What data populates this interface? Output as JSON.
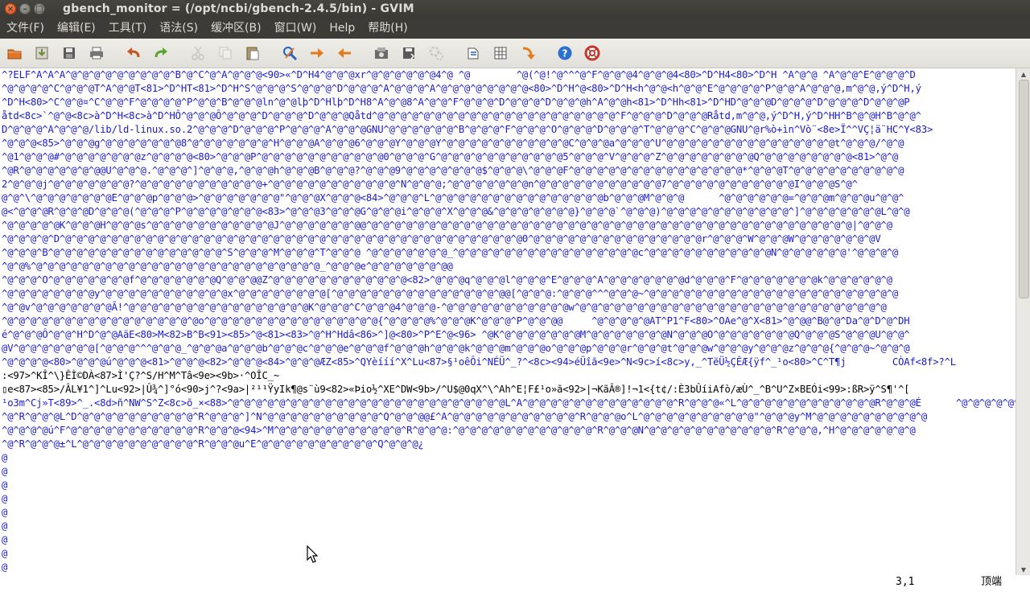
{
  "window": {
    "title": "gbench_monitor = (/opt/ncbi/gbench-2.4.5/bin) - GVIM",
    "close_glyph": "×",
    "min_glyph": "–",
    "max_glyph": "□"
  },
  "menubar": {
    "items": [
      "文件(F)",
      "编辑(E)",
      "工具(T)",
      "语法(S)",
      "缓冲区(B)",
      "窗口(W)",
      "Help",
      "帮助(H)"
    ]
  },
  "toolbar": {
    "buttons": [
      {
        "icon": "open-folder-icon",
        "color": "#e0762a"
      },
      {
        "icon": "download-save-icon",
        "color": "#6a8f2c"
      },
      {
        "icon": "save-disk-icon",
        "color": "#555555"
      },
      {
        "icon": "print-icon",
        "color": "#666666"
      },
      {
        "icon": "undo-icon",
        "color": "#c8551c"
      },
      {
        "icon": "redo-icon",
        "color": "#5aa632"
      },
      {
        "icon": "cut-icon",
        "color": "#888888"
      },
      {
        "icon": "copy-icon",
        "color": "#888888"
      },
      {
        "icon": "paste-icon",
        "color": "#7a6a4a"
      },
      {
        "icon": "find-replace-icon",
        "color": "#2b5fb8"
      },
      {
        "icon": "find-next-icon",
        "color": "#e37b1c"
      },
      {
        "icon": "find-prev-icon",
        "color": "#e37b1c"
      },
      {
        "icon": "load-session-icon",
        "color": "#555555"
      },
      {
        "icon": "save-session-icon",
        "color": "#555555"
      },
      {
        "icon": "run-script-icon",
        "color": "#888888"
      },
      {
        "icon": "make-icon",
        "color": "#2b5fb8"
      },
      {
        "icon": "build-tags-icon",
        "color": "#555555"
      },
      {
        "icon": "jump-tag-icon",
        "color": "#e37b1c"
      },
      {
        "icon": "help-icon",
        "color": "#2b6fd0"
      },
      {
        "icon": "find-help-icon",
        "color": "#c0392b"
      }
    ]
  },
  "editor": {
    "text_color": "#1a1ad0",
    "lines": [
      "^?ELF^A^A^A^@^@^@^@^@^@^@^@^@^B^@^C^@^A^@^@^@<90>«^D^H4^@^@^@xr^@^@^@^@^@^@4^@ ^@        ^@(^@!^@^^^@^F^@^@^@4^@^@^@4<80>^D^H4<80>^D^H ^A^@^@ ^A^@^@^E^@^@^@^D",
      "^@^@^@^@^C^@^@^@T^A^@^@T<81>^D^HT<81>^D^H^S^@^@^@^S^@^@^@^D^@^@^@^A^@^@^@^A^@^@^@^@^@^@^@^@<80>^D^H^@<80>^D^H<h^@^@<h^@^@^E^@^@^@^@^P^@^@^A^@^@^@,m^@^@,ý^D^H,ý",
      "^D^H<80>^C^@^@¤^C^@^@^F^@^@^@^@^P^@^@^B^@^@^@ln^@^@lþ^D^Hlþ^D^H8^A^@^@8^A^@^@^F^@^@^@^D^@^@^@^D^@^@^@h^A^@^@h<81>^D^Hh<81>^D^HD^@^@^@D^@^@^@^D^@^@^@^D^@^@^@P",
      "åtd<8c>`^@^@<8c>à^D^H<8c>à^D^HÔ^@^@^@Ô^@^@^@^D^@^@^@^D^@^@^@Qåtd^@^@^@^@^@^@^@^@^@^@^@^@^@^@^@^@^@^@^@^@^@^F^@^@^@^D^@^@^@Råtd,m^@^@,ý^D^H,ý^D^HH^B^@^@H^B^@^@^",
      "D^@^@^@^A^@^@^@/lib/ld-linux.so.2^@^@^@^D^@^@^@^P^@^@^@^A^@^@^@GNU^@^@^@^@^@^@^B^@^@^@^F^@^@^@^O^@^@^@^D^@^@^@^T^@^@^@^C^@^@^@GNU^@r%ò+ìn^Vò¨<8e>Ï^^VÇ¦ä¨HC^Y<83>",
      "^@^@^@<85>^@^@^@g^@^@^@^@^@^@^@8^@^@^@^@^@^@^@^H^@^@^@A^@^@^@6^@^@^@Y^@^@^@Y^@^@^@^@^@^@^@^@^@^@^@C^@^@^@a^@^@^@^U^@^@^@^@^@^@^@^@^@^@^@^@^@^@^@t^@^@^@/^@^@",
      "^@1^@^@^@#^@^@^@^@^@^@^@z^@^@^@^@<80>^@^@^@P^@^@^@^@^@^@^@^@^@^@^@0^@^@^@^G^@^@^@^@^@^@^@^@^@^@^@5^@^@^@^V^@^@^@^Z^@^@^@^@^@^@^@^@Q^@^@^@^@^@^@^@^@<81>^@^@",
      "^@R^@^@^@^@^@^@^@@U^@^@^@.^@^@^@^]^@^@^@,^@^@^@h^@^@^@B^@^@^@?^@^@^@9^@^@^@^@^@^@^@$^@^@^@\\^@^@^@F^@^@^@^@^@^@^@^@^@^@^@^@^@^@^@*^@^@^@T^@^@^@^@^@^@^@^@^@^@",
      "2^@^@^@j^@^@^@^@^@^@^@?^@^@^@^@^@^@^@^@^@^@^@+^@^@^@^@^@^@^@^@^@^@^@^N^@^@^@;^@^@^@^@^@^@^@n^@^@^@^@^@^@^@^@^@^@^@7^@^@^@^@^@^@^@^@^@^@^@I^@^@^@S^@^",
      "@^@^\\^@^@^@^@^@^@^@E^@^@^@p^@^@^@>^@^@^@^@^@^@^@\"^@^@^@X^@^@^@<84>^@^@^@^L^@^@^@^@^@^@^@^@^@^@^@^@^@^@^@b^@^@^@M^@^@^@      ^@^@^@^@^@^@=^@^@^@m^@^@^@u^@^@^",
      "@<^@^@^@R^@^@^@D^@^@^@(^@^@^@^P^@^@^@^@^@^@^@<83>^@^@^@3^@^@^@G^@^@^@i^@^@^@^X^@^@^@&^@^@^@^@^@^@^@}^@^@^@`^@^@^@)^@^@^@^@^@^@^@^@^@^@^@^]^@^@^@^@^@^@^@L^@^@",
      "^@^@^@^@^@K^@^@^@H^@^@^@s^@^@^@^@^@^@^@^@^@^@^@J^@^@^@^@^@^@^@@^@^@^@^@^@^@^@^@^@^@^@^@^@^@^@^@^@^@^@^@^@^@^@^@^@^@^@^@^@^@^@^@^@^@^@^@^@^@^@^@^@^@|^@^@^@",
      "^@^@^@^@^D^@^@^@^@^@^@^@^@^@^@^@^@^@^@^@^@^@^@^@^@^@^@^@^@^@^@^@^@^@^@^@^@^@^@^@^@^@^@^@^@0^@^@^@^@^@^@^@^@^@^@^@^@^@^@^@r^@^@^@^W^@^@^@W^@^@^@^@^@^@^@V",
      "^@^@^@^B^@^@^@^@^@^@^@^@^@^@^@^@^@^@^@^S^@^@^@^M^@^@^@^T^@^@^@ ^@^@^@^@^@^@^@_^@^@^@^@^@^@^@^@^@^@^@^@^@^@^@^@c^@^@^@^@^@^@^@^@^@^@^@N^@^@^@^@^@^@'^@^@^@^@",
      "^@^@%^@^@^@^@^@^@^@^@^@^@^@^@^@^@^@^@^@^@^@^@^@^@^@^@^@_^@^@^@e^@^@^@^@^@^@^@@",
      "^@^@^@^O^@^@^@^@^@^@^@f^@^@^@^@^@^@^@Q^@^@^@@Z^@^@^@^@^@^@^@^@^@^@^@^@<82>^@^@^@q^@^@^@l^@^@^@^E^@^@^@^A^@^@^@^@^@^@^@d^@^@^@^F^@^@^@^@^@^@^@k^@^@^@^@^@^@",
      "^@^@^@^@^@^@^@^@y^@^@^@^@^@^@^@^@^@^@^@x^@^@^@^@^@^@^@^@[^@^@^@^@^@^@^@^@^@^@^@^@^@^@^@@[^@^@^@:^@^@^@^^^@^@^@~^@^@^@^@^@^@^@^@^@^@^@^@^@^@^@^@^@^@^@^@^@^@",
      "^@^@v^@^@^@^@^@^@^@Ã!^@^@^@^@^@^@^@^@^@^@^@^@^@^@^@^@K^@^@^@^C^@^@^@4^@^@^@-^@^@^@^@^@^@^@^@^@^@^@w^@^@^@^@^@^@^@^@^@^@^@^@^@^@^@^@^@^@^@^@^@^@^@^@^@^@^@",
      "^@^@^@^@^@^@^@^@^@^@^@^@^@^@^@^@^@o^@^@^@^@^@^@^@^@^@^@^@^@^@^@^@{^@^@^@^@%^@^@^@K^@^@^@^P^@^@^@@     ^@^@^@^@^@AT^P1^F<80>^OAe^@^X<81>^@^@@^B@^@^Da^@^D^@^DH",
      "é^@^@^@Ô^@^@^H^D^@^@AäE<80>M<82>B^B<91><85>^@<81><83>^@^H^Hdâ<86>^]@<80>^P^E^@<96> ^@K^@^@^@^@^@^@^@M^@^@^@^@^@^@^@N^@^@^@O^@^@^@^@^@^@^@Q^@^@^@S^@^@^@U^@^@^",
      "@V^@^@^@^@^@^@^@[^@^@^@^^^@^@^@_^@^@^@a^@^@^@b^@^@^@c^@^@^@e^@^@^@f^@^@^@h^@^@^@k^@^@^@m^@^@^@o^@^@^@p^@^@^@r^@^@^@t^@^@^@w^@^@^@y^@^@^@z^@^@^@{^@^@^@~^@^@^@",
      "^@^@^@^@<80>^@^@^@ú^@^@^@<81>^@^@^@<82>^@^@^@<84>^@^@^@ÆZ<85>^QYèííí^X^Lu<87>§¹oêÔi^NÉÜ^_?^<8c><94>éÜîã<9e>^N<9c>í<8c>y,_^TëÜ½ÇÊÆ{ÿf^_¹o<80>^C^T¶j        CÒAf<8f>?^L",
      ":<97>^KÎ^\\}ÊÌ©DÀ<87>Ì'Ç?^S/H^M^Tâ<9e><9b>·^OÎC_~",
      "▯e<87><85>/ÂL¥1^]^Lu<92>|Û¾^]°ó<90>j^?<9a>|²¹¹ŸyIk¶@s¨ù9<82>«Þio½^XE^DW<9b>/^U$@0qX^\\^Ah^E¦F£¹o»ã<92>|¬KãÂ®]!¬1<{t¢/:È3bÛíiAfò/æÙ^_^B^U^Z×BEÓi<99>:ßR>ÿ^S¶'^[",
      "¹o3m^Cj»T<89>^_.<8d>ñ^NW^S^Z<8c>õ_×<88>^@^@^@^@^@^@^@^@^@^@^@^@^@^@^@^@^@^@^@^@^@^@^@^@L^A^@^@^@^@^@^@^@^@^@^@^@^@^@^R^@^@^@«^L^@^@^@^@^@^@^@^@^@^@^@^@R^@^@^@É      ^@^@^@^@^@^@^@^@^@^@^@^@^@^@",
      "^@^R^@^@^@L^D^@^@^@^@^@^@^@^@^@^@^R^@^@^@^]^N^@^@^@^@^@^@^@^@^@^@^Q^@^@^@@£^A^@^@^@^@^@^@^@^@^@^@^@^R^@^@^@o^L^@^@^@^@^@^@^@^@^@^@\"^@^@^@y^M^@^@^@^@^@^@^@^@^@^@",
      "^@^@^@^@ú^F^@^@^@^@^@^@^@^@^@^@^@^R^@^@^@<94>^M^@^@^@^@^@^@^@^@^@^@^@^R^@^@^@:^@^@^@^@^@^@^@^@^@^@^@^@^R^@^@^@N^@^@^@^@^@^@^@^@^@^@^@^R^@^@^@,^H^@^@^@^@^@^@^@",
      "^@^R^@^@^@±^L^@^@^@^@^@^@^@^@^@^@^R^@^@^@u^E^@^@^@^@^@^@^@^@^@^@^Q^@^@^@¿"
    ],
    "filler_lines": [
      "@",
      "@",
      "@",
      "@",
      "@",
      "@",
      "@",
      "@",
      "@"
    ]
  },
  "statusline": {
    "ruler": "3,1",
    "position": "顶端"
  }
}
